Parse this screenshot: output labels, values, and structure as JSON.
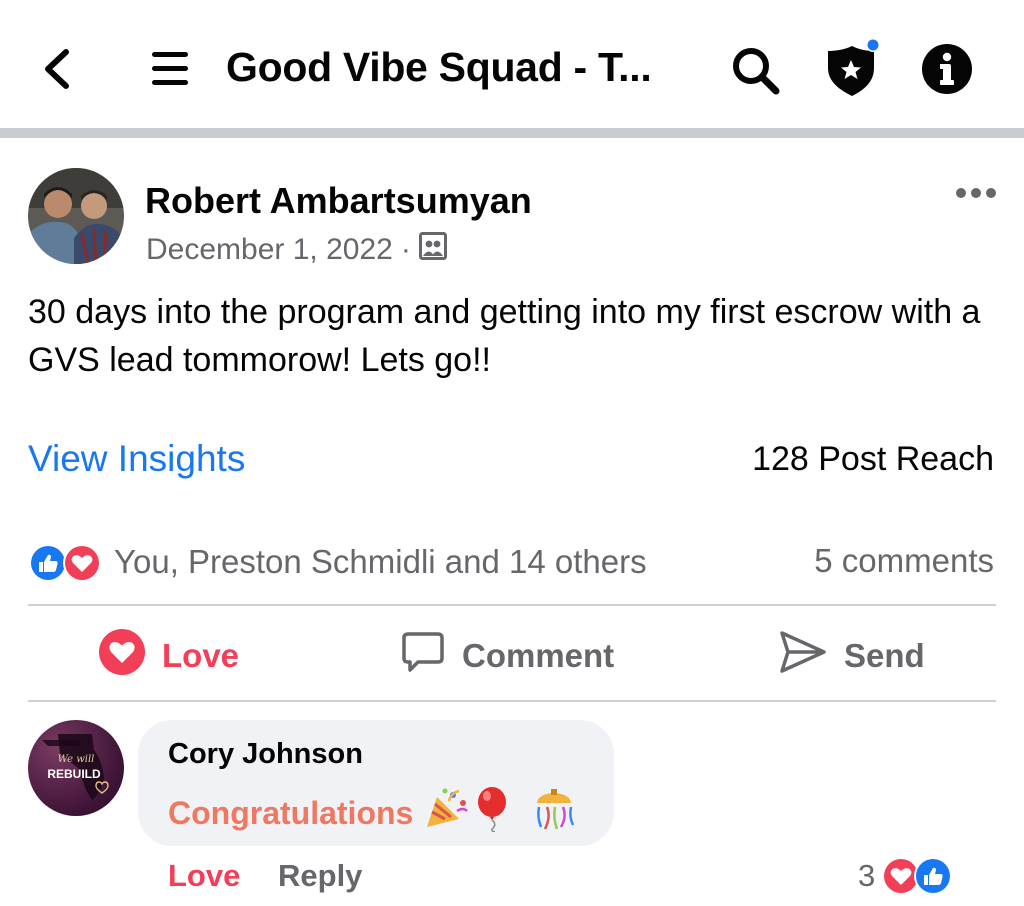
{
  "header": {
    "title": "Good Vibe Squad - T...",
    "icons": [
      "back-arrow-icon",
      "menu-icon",
      "search-icon",
      "admin-shield-icon",
      "info-icon"
    ],
    "shield_notification_color": "#1877f2"
  },
  "post": {
    "author": "Robert Ambartsumyan",
    "date": "December 1, 2022",
    "separator": "·",
    "privacy_icon": "group-members-icon",
    "text": "30 days into the program and getting into my first escrow with a GVS lead tommorow! Lets go!!",
    "insights_label": "View Insights",
    "reach": "128 Post Reach",
    "reactions_text": "You, Preston Schmidli and 14 others",
    "comments_count": "5 comments"
  },
  "actions": {
    "love_label": "Love",
    "comment_label": "Comment",
    "send_label": "Send"
  },
  "comment": {
    "author": "Cory Johnson",
    "text": "Congratulations",
    "emojis": [
      "party-popper",
      "balloon",
      "confetti-ball"
    ],
    "avatar_text_top": "We will",
    "avatar_text_bottom": "REBUILD",
    "love_label": "Love",
    "reply_label": "Reply",
    "reaction_count": "3"
  },
  "colors": {
    "link_blue": "#1877f2",
    "love_red": "#f33e58",
    "secondary_text": "#65676b",
    "comment_text": "#f07860",
    "bubble_bg": "#f0f2f5"
  }
}
